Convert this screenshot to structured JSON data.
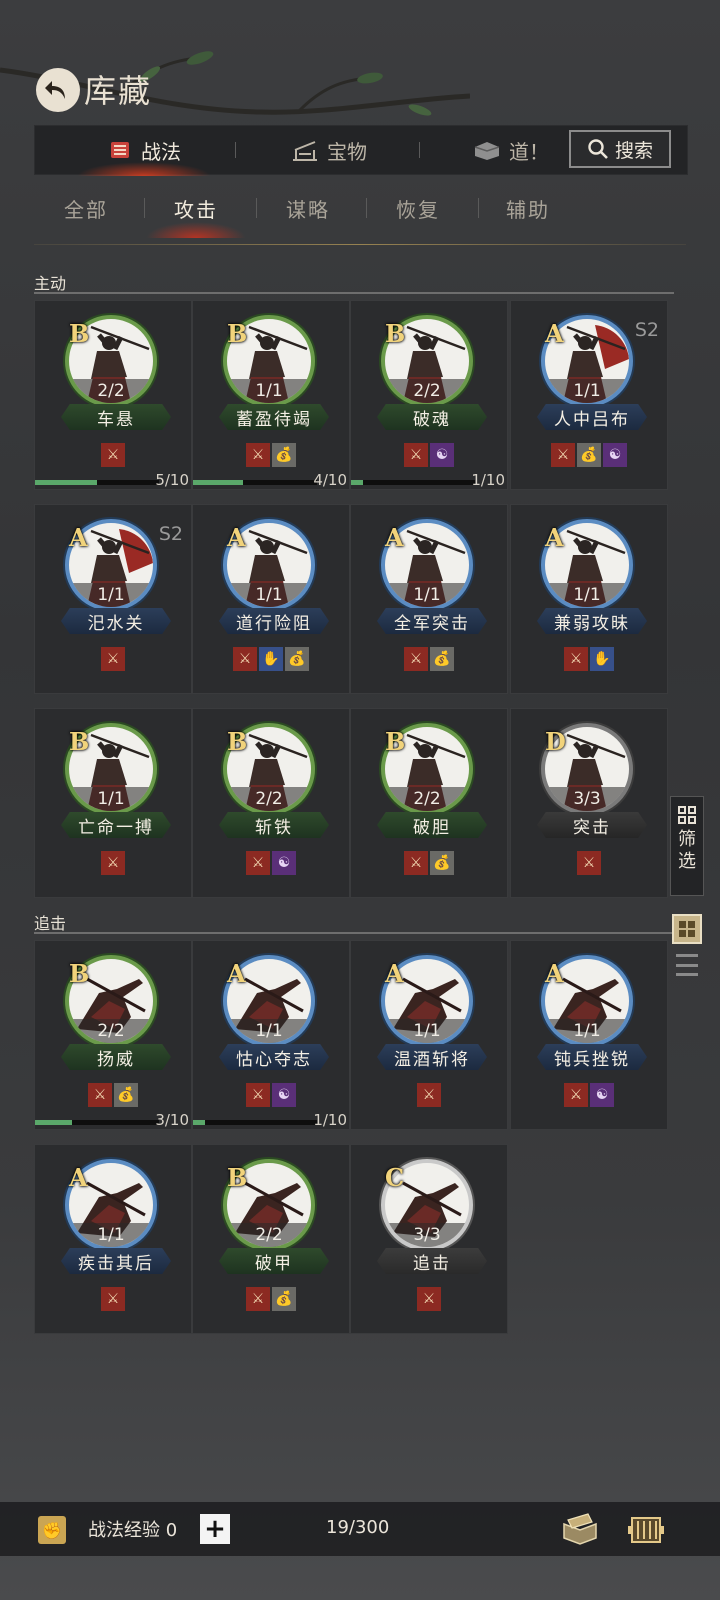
{
  "header": {
    "title": "库藏",
    "back_icon": "back-arrow-icon"
  },
  "top_tabs": [
    {
      "label": "战法",
      "icon": "scroll-icon",
      "active": true
    },
    {
      "label": "宝物",
      "icon": "weapon-rack-icon",
      "active": false
    },
    {
      "label": "道！",
      "icon": "item-box-icon",
      "active": false
    }
  ],
  "search": {
    "label": "搜索",
    "icon": "search-icon"
  },
  "sub_tabs": [
    {
      "label": "全部",
      "active": false
    },
    {
      "label": "攻击",
      "active": true
    },
    {
      "label": "谋略",
      "active": false
    },
    {
      "label": "恢复",
      "active": false
    },
    {
      "label": "辅助",
      "active": false
    }
  ],
  "sections": [
    {
      "title": "主动",
      "cards": [
        {
          "grade": "B",
          "count": "2/2",
          "name": "车悬",
          "tags": [
            "atk"
          ],
          "progress": {
            "text": "5/10",
            "value": 0.5
          }
        },
        {
          "grade": "B",
          "count": "1/1",
          "name": "蓄盈待竭",
          "tags": [
            "atk",
            "bag"
          ],
          "progress": {
            "text": "4/10",
            "value": 0.4
          }
        },
        {
          "grade": "B",
          "count": "2/2",
          "name": "破魂",
          "tags": [
            "atk",
            "ctl"
          ],
          "progress": {
            "text": "1/10",
            "value": 0.1
          }
        },
        {
          "grade": "A",
          "count": "1/1",
          "name": "人中吕布",
          "tags": [
            "atk",
            "bag",
            "ctl"
          ],
          "season": "S2",
          "red": true
        },
        {
          "grade": "A",
          "count": "1/1",
          "name": "汜水关",
          "tags": [
            "atk"
          ],
          "season": "S2",
          "red": true
        },
        {
          "grade": "A",
          "count": "1/1",
          "name": "道行险阻",
          "tags": [
            "atk",
            "hand",
            "bag"
          ]
        },
        {
          "grade": "A",
          "count": "1/1",
          "name": "全军突击",
          "tags": [
            "atk",
            "bag"
          ]
        },
        {
          "grade": "A",
          "count": "1/1",
          "name": "兼弱攻昧",
          "tags": [
            "atk",
            "hand"
          ]
        },
        {
          "grade": "B",
          "count": "1/1",
          "name": "亡命一搏",
          "tags": [
            "atk"
          ]
        },
        {
          "grade": "B",
          "count": "2/2",
          "name": "斩铁",
          "tags": [
            "atk",
            "ctl"
          ]
        },
        {
          "grade": "B",
          "count": "2/2",
          "name": "破胆",
          "tags": [
            "atk",
            "bag"
          ]
        },
        {
          "grade": "D",
          "count": "3/3",
          "name": "突击",
          "tags": [
            "atk"
          ]
        }
      ]
    },
    {
      "title": "追击",
      "cards": [
        {
          "grade": "B",
          "count": "2/2",
          "name": "扬威",
          "tags": [
            "atk",
            "bag"
          ],
          "progress": {
            "text": "3/10",
            "value": 0.3
          }
        },
        {
          "grade": "A",
          "count": "1/1",
          "name": "怙心夺志",
          "tags": [
            "atk",
            "ctl"
          ],
          "progress": {
            "text": "1/10",
            "value": 0.1
          }
        },
        {
          "grade": "A",
          "count": "1/1",
          "name": "温酒斩将",
          "tags": [
            "atk"
          ]
        },
        {
          "grade": "A",
          "count": "1/1",
          "name": "钝兵挫锐",
          "tags": [
            "atk",
            "ctl"
          ]
        },
        {
          "grade": "A",
          "count": "1/1",
          "name": "疾击其后",
          "tags": [
            "atk"
          ]
        },
        {
          "grade": "B",
          "count": "2/2",
          "name": "破甲",
          "tags": [
            "atk",
            "bag"
          ]
        },
        {
          "grade": "C",
          "count": "3/3",
          "name": "追击",
          "tags": [
            "atk"
          ]
        }
      ]
    }
  ],
  "side": {
    "filter_label": "筛选",
    "filter_icon": "filter-grid-icon",
    "grid_view_icon": "grid-view-icon",
    "list_view_icon": "list-view-icon"
  },
  "footer": {
    "exp_label": "战法经验 0",
    "exp_icon": "fist-icon",
    "plus": "+",
    "capacity": "19/300",
    "convert_icon": "book-convert-icon",
    "storage_icon": "scroll-storage-icon"
  },
  "colors": {
    "grade_text": "#f1d37b",
    "ring_B": "#6a9a4a",
    "ring_A": "#5b8cc2",
    "ring_C": "#c9c9c9",
    "ring_D": "#7a7a7a",
    "progress": "#5aa86a"
  }
}
